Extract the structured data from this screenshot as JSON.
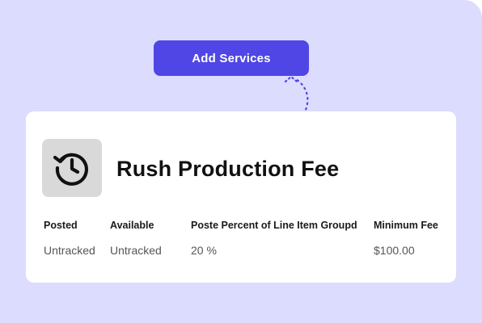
{
  "colors": {
    "background": "#dcdcfe",
    "button": "#4f46e5",
    "button_text": "#ffffff",
    "card": "#ffffff",
    "icon_tile": "#d9d9d9",
    "connector": "#4f46e5"
  },
  "toolbar": {
    "add_services_label": "Add Services"
  },
  "service": {
    "icon": "history-clock-icon",
    "name": "Rush Production Fee",
    "columns": [
      {
        "header": "Posted",
        "value": "Untracked"
      },
      {
        "header": "Available",
        "value": "Untracked"
      },
      {
        "header": "Poste Percent of Line Item Groupd",
        "value": "20 %"
      },
      {
        "header": "Minimum Fee",
        "value": "$100.00"
      }
    ]
  }
}
